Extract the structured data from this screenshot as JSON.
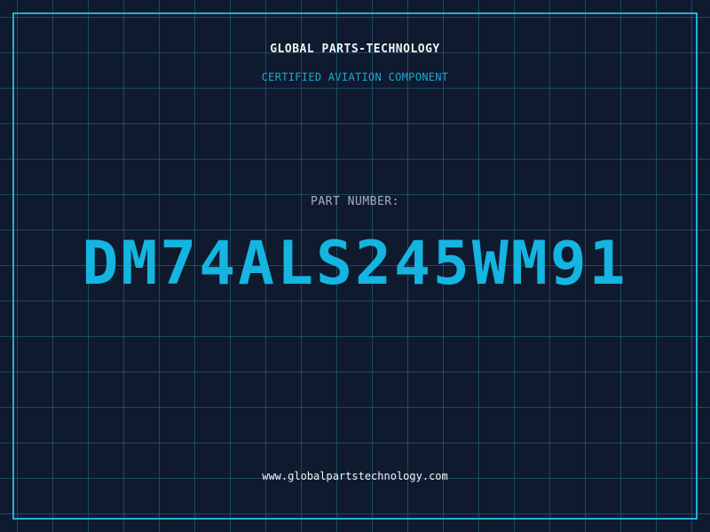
{
  "header": {
    "company": "GLOBAL PARTS-TECHNOLOGY",
    "certification": "CERTIFIED AVIATION COMPONENT"
  },
  "part": {
    "label": "PART NUMBER:",
    "number": "DM74ALS245WM91"
  },
  "footer": {
    "url": "www.globalpartstechnology.com"
  },
  "colors": {
    "background": "#0f1a2e",
    "grid": "#286e8c",
    "accent": "#14b5e0",
    "frame": "#1fb2d8"
  }
}
